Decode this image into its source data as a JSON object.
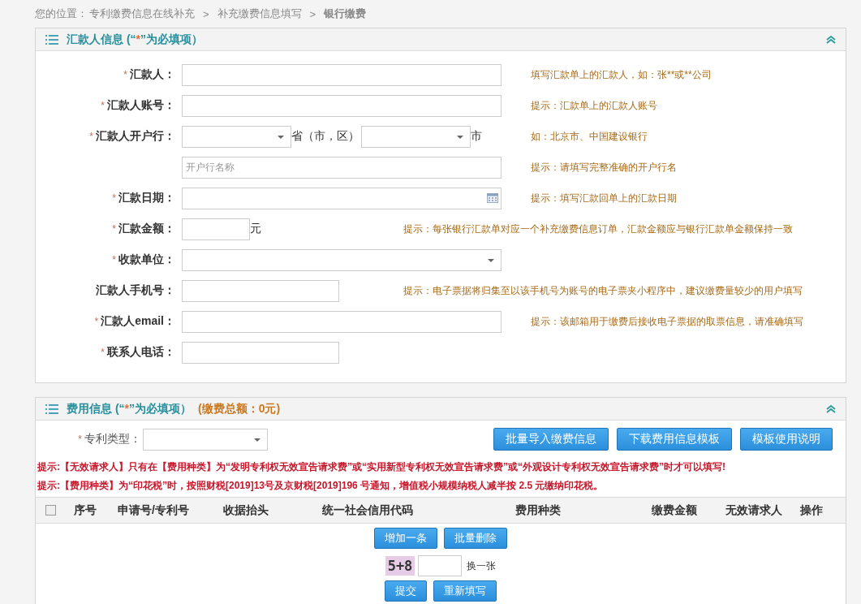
{
  "breadcrumb": {
    "label": "您的位置：",
    "separator": ">",
    "path": [
      "专利缴费信息在线补充",
      "补充缴费信息填写"
    ],
    "current": "银行缴费"
  },
  "payer": {
    "title": "汇款人信息",
    "note_open": "(“",
    "star": "*",
    "note_close": "”为必填项）",
    "expanded": true,
    "fields": [
      {
        "kind": "text",
        "label": "汇款人：",
        "required": true,
        "hint": "填写汇款单上的汇款人，如：张**或**公司"
      },
      {
        "kind": "text",
        "label": "汇款人账号：",
        "required": true,
        "hint": "提示：汇款单上的汇款人账号"
      },
      {
        "kind": "region",
        "label": "汇款人开户行：",
        "required": true,
        "selects": [
          {
            "suffix": "省（市，区）"
          },
          {
            "suffix": "市"
          }
        ],
        "hint": "如：北京市、中国建设银行"
      },
      {
        "kind": "text",
        "placeholder": "开户行名称",
        "hint": "提示：请填写完整准确的开户行名"
      },
      {
        "kind": "date",
        "label": "汇款日期：",
        "required": true,
        "hint": "提示：填写汇款回单上的汇款日期"
      },
      {
        "kind": "amount",
        "label": "汇款金额：",
        "required": true,
        "unit": "元",
        "hint": "提示：每张银行汇款单对应一个补充缴费信息订单，汇款金额应与银行汇款单金额保持一致"
      },
      {
        "kind": "select",
        "label": "收款单位：",
        "required": true
      },
      {
        "kind": "short",
        "label": "汇款人手机号：",
        "required": false,
        "hint": "提示：电子票据将归集至以该手机号为账号的电子票夹小程序中，建议缴费量较少的用户填写"
      },
      {
        "kind": "text",
        "label": "汇款人email：",
        "required": true,
        "hint": "提示：该邮箱用于缴费后接收电子票据的取票信息，请准确填写"
      },
      {
        "kind": "short",
        "label": "联系人电话：",
        "required": true
      }
    ]
  },
  "fees": {
    "title": "费用信息",
    "note_open": "(“",
    "star": "*",
    "note_close": "”为必填项）",
    "total": "(缴费总额：0元)",
    "expanded": true,
    "patent_type": {
      "label": "专利类型：",
      "required": true
    },
    "buttons": [
      "批量导入缴费信息",
      "下载费用信息模板",
      "模板使用说明"
    ],
    "notes": [
      "提示:【无效请求人】只有在【费用种类】为“发明专利权无效宣告请求费”或“实用新型专利权无效宣告请求费”或“外观设计专利权无效宣告请求费”时才可以填写!",
      "提示:【费用种类】为“印花税”时，按照财税[2019]13号及京财税[2019]196 号通知，增值税小规模纳税人减半按 2.5 元缴纳印花税。"
    ],
    "table": {
      "all_checked": false,
      "columns": [
        "序号",
        "申请号/专利号",
        "收据抬头",
        "统一社会信用代码",
        "费用种类",
        "缴费金额",
        "无效请求人",
        "操作"
      ]
    },
    "row_buttons": [
      "增加一条",
      "批量删除"
    ],
    "captcha": {
      "code": "5+8",
      "refresh": "换一张"
    },
    "submit_buttons": [
      "提交",
      "重新填写"
    ]
  }
}
